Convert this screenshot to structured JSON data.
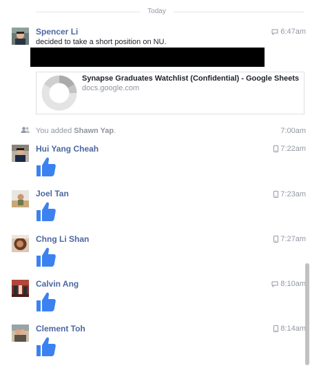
{
  "divider": {
    "label": "Today"
  },
  "first_message": {
    "sender": "Spencer Li",
    "time": "6:47am",
    "time_icon": "chat-bubble-icon",
    "text": "decided to take a short position on NU.",
    "link": {
      "title": "Synapse Graduates Watchlist (Confidential) - Google Sheets",
      "domain": "docs.google.com"
    }
  },
  "system": {
    "prefix": "You added ",
    "name": "Shawn Yap",
    "suffix": ".",
    "time": "7:00am"
  },
  "likes": [
    {
      "sender": "Hui Yang Cheah",
      "time": "7:22am",
      "time_icon": "mobile-phone-icon"
    },
    {
      "sender": "Joel Tan",
      "time": "7:23am",
      "time_icon": "mobile-phone-icon"
    },
    {
      "sender": "Chng Li Shan",
      "time": "7:27am",
      "time_icon": "mobile-phone-icon"
    },
    {
      "sender": "Calvin Ang",
      "time": "8:10am",
      "time_icon": "chat-bubble-icon"
    },
    {
      "sender": "Clement Toh",
      "time": "8:14am",
      "time_icon": "mobile-phone-icon"
    }
  ],
  "colors": {
    "name": "#4b67a1",
    "like": "#3b82f0",
    "meta": "#9197a3"
  }
}
